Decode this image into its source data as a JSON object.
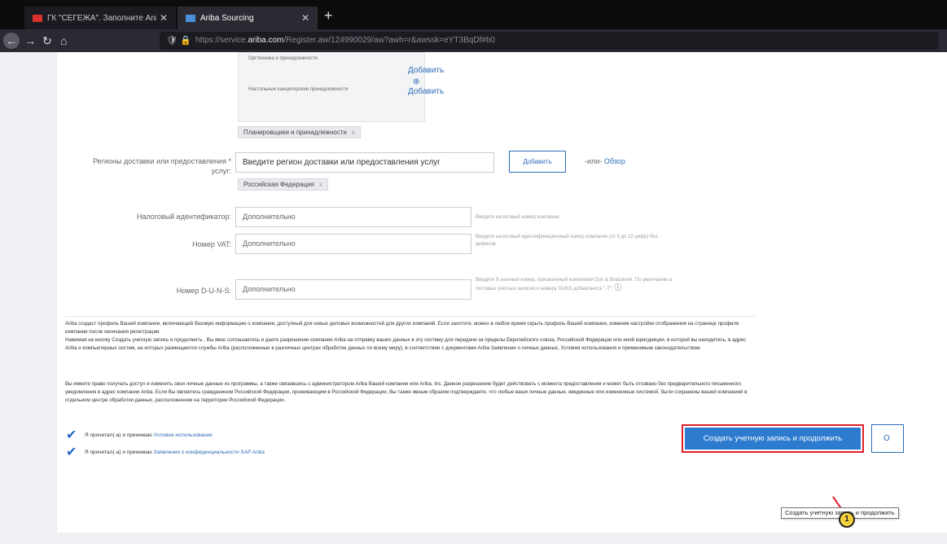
{
  "browser": {
    "tabs": [
      {
        "title": "ГК \"СЕГЕЖА\". Заполните Ani",
        "close": "✕"
      },
      {
        "title": "Ariba Sourcing",
        "close": "✕"
      }
    ],
    "new_tab": "+",
    "nav": {
      "back": "←",
      "forward": "→",
      "reload": "↻",
      "home": "⌂"
    },
    "url_prefix": "https://service.",
    "url_domain": "ariba.com",
    "url_suffix": "/Register.aw/124990029/aw?awh=r&awssk=eYT3BqDf#b0"
  },
  "commodities": {
    "row1_label": "Оргтехника и принадлежности",
    "row2_label": "Настольные канцелярские принадлежности",
    "add_label_1": "Добавить",
    "add_label_2": "Добавить",
    "plus": "⊕",
    "selected_pill": "Планировщики и принадлежности",
    "pill_x": "x"
  },
  "regions": {
    "label_line1": "Регионы доставки или предоставления",
    "label_line2": "услуг:",
    "required_mark": "*",
    "placeholder": "Введите регион доставки или предоставления услуг",
    "add_button": "Добавить",
    "or": "-или-",
    "browse": "Обзор",
    "selected_pill": "Российская Федерация",
    "pill_x": "x"
  },
  "tax_id": {
    "label": "Налоговый идентификатор:",
    "placeholder": "Дополнительно",
    "hint": "Введите налоговый номер компании."
  },
  "vat": {
    "label": "Номер VAT:",
    "placeholder": "Дополнительно",
    "hint_line1": "Введите налоговый идентификационный номер компании (от 5 до 12 цифр) без",
    "hint_line2": "дефисов."
  },
  "duns": {
    "label": "Номер D-U-N-S:",
    "placeholder": "Дополнительно",
    "hint_line1": "Введите 9-значный номер, присвоенный компанией Dun & Bradstreet. По умолчанию в",
    "hint_line2": "тестовых учетных записях к номеру DUNS добавляется \"-T\".",
    "info_icon": "ⓘ"
  },
  "legal": {
    "p1": "Ariba создаст профиль Вашей компании, включающий базовую информацию о компании, доступный для новых деловых возможностей для других компаний. Если захотите, можно в любое время скрыть профиль Вашей компании, изменив настройки отображения на странице профиля компании после окончания регистрации.",
    "p2": "Нажимая на кнопку Создать учетную запись и продолжить , Вы явно соглашаетесь и даете разрешение компании Ariba на отправку ваших данных в эту систему для передачи за пределы Европейского союза, Российской Федерации или иной юрисдикции, в которой вы находитесь, в адрес Ariba и компьютерных систем, на которых размещаются службы Ariba (расположенные в различных центрах обработки данных по всему миру), в соответствии с документами Ariba Заявление о личных данных, Условия использования и применимым законодательством.",
    "p3": "Вы имеете право получать доступ и изменять свои личные данные из программы, а также связавшись с администратором Ariba Вашей компании или Ariba, Inc. Данное разрешение будет действовать с момента предоставления и может быть отозвано без предварительного письменного уведомления в адрес компании Ariba. Если Вы являетесь гражданином Российской Федерации, проживающим в Российской Федерации, Вы также явным образом подтверждаете, что любые ваши личные данные, введенные или измененные системой, были сохранены вашей компанией в отдельном центре обработки данных, расположенном на территории Российской Федерации."
  },
  "agreements": [
    {
      "prefix": "Я прочитал(-а) и принимаю",
      "link": "Условия использования",
      "checked_glyph": "✔"
    },
    {
      "prefix": "Я прочитал(-а) и принимаю",
      "link": "Заявления о конфиденциальности SAP Ariba",
      "checked_glyph": "✔"
    }
  ],
  "actions": {
    "create_button": "Создать учетную запись и продолжить",
    "other_button": "О",
    "tooltip": "Создать учетную запись и продолжить",
    "step_marker": "1"
  },
  "colors": {
    "accent": "#2d7bcf",
    "highlight": "#e01e2a",
    "link": "#2e6db8"
  }
}
